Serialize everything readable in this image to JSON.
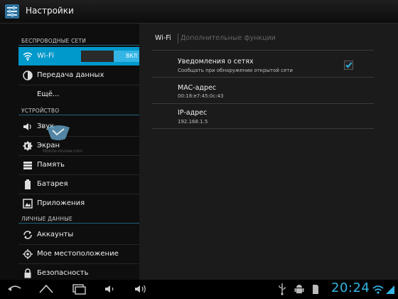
{
  "app": {
    "title": "Настройки"
  },
  "sidebar": {
    "sections": [
      {
        "header": "БЕСПРОВОДНЫЕ СЕТИ"
      },
      {
        "header": "УСТРОЙСТВО"
      },
      {
        "header": "ЛИЧНЫЕ ДАННЫЕ"
      }
    ],
    "items": [
      {
        "label": "Wi-Fi",
        "icon": "wifi-icon",
        "selected": true,
        "toggle": "ВКЛ"
      },
      {
        "label": "Передача данных",
        "icon": "data-usage-icon"
      },
      {
        "label": "Ещё..."
      },
      {
        "label": "Звук",
        "icon": "speaker-icon"
      },
      {
        "label": "Экран",
        "icon": "brightness-icon"
      },
      {
        "label": "Память",
        "icon": "storage-icon"
      },
      {
        "label": "Батарея",
        "icon": "battery-icon"
      },
      {
        "label": "Приложения",
        "icon": "apps-icon"
      },
      {
        "label": "Аккаунты",
        "icon": "sync-icon"
      },
      {
        "label": "Мое местоположение",
        "icon": "location-icon"
      },
      {
        "label": "Безопасность",
        "icon": "lock-icon"
      }
    ]
  },
  "detail": {
    "tab_title": "Wi-Fi",
    "tab_extra": "Дополнительные функции",
    "prefs": [
      {
        "title": "Уведомления о сетях",
        "summary": "Сообщать при обнаружении открытой сети",
        "checked": true
      },
      {
        "title": "MAC-адрес",
        "summary": "00:18:e7:45:0c:43"
      },
      {
        "title": "IP-адрес",
        "summary": "192.168.1.5"
      }
    ]
  },
  "navbar": {
    "clock": "20:24",
    "icons": [
      "back-icon",
      "home-icon",
      "recent-apps-icon",
      "volume-down-icon",
      "volume-up-icon",
      "usb-icon",
      "android-debug-icon",
      "sd-card-icon",
      "wifi-signal-icon"
    ]
  },
  "watermark": {
    "text": "Mobile-review.com"
  },
  "colors": {
    "accent": "#33b5e5",
    "selected": "#0099cc"
  }
}
